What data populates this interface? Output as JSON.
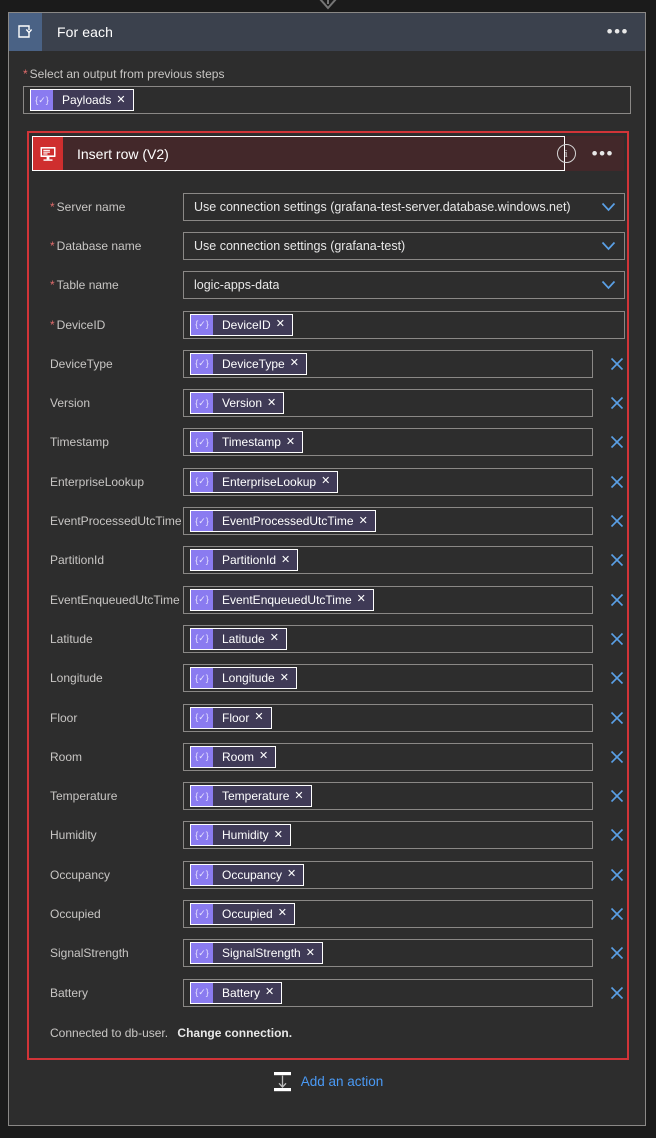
{
  "foreach": {
    "icon": "loop-icon",
    "title": "For each",
    "menu_label": "•••",
    "select_output": {
      "required_marker": "*",
      "label": "Select an output from previous steps",
      "token": {
        "icon_glyph": "{✓}",
        "label": "Payloads",
        "remove": "✕"
      }
    }
  },
  "action": {
    "icon": "sql-server-icon",
    "title": "Insert row (V2)",
    "info_label": "i",
    "menu_label": "•••",
    "accent_color": "#d13438",
    "header_bg": "#43282a",
    "dropdowns": [
      {
        "label": "Server name",
        "required": true,
        "value": "Use connection settings (grafana-test-server.database.windows.net)"
      },
      {
        "label": "Database name",
        "required": true,
        "value": "Use connection settings (grafana-test)"
      },
      {
        "label": "Table name",
        "required": true,
        "value": "logic-apps-data"
      }
    ],
    "fields": [
      {
        "label": "DeviceID",
        "required": true,
        "token": "DeviceID",
        "removable": false
      },
      {
        "label": "DeviceType",
        "required": false,
        "token": "DeviceType",
        "removable": true
      },
      {
        "label": "Version",
        "required": false,
        "token": "Version",
        "removable": true
      },
      {
        "label": "Timestamp",
        "required": false,
        "token": "Timestamp",
        "removable": true
      },
      {
        "label": "EnterpriseLookup",
        "required": false,
        "token": "EnterpriseLookup",
        "removable": true
      },
      {
        "label": "EventProcessedUtcTime",
        "required": false,
        "token": "EventProcessedUtcTime",
        "removable": true
      },
      {
        "label": "PartitionId",
        "required": false,
        "token": "PartitionId",
        "removable": true
      },
      {
        "label": "EventEnqueuedUtcTime",
        "required": false,
        "token": "EventEnqueuedUtcTime",
        "removable": true
      },
      {
        "label": "Latitude",
        "required": false,
        "token": "Latitude",
        "removable": true
      },
      {
        "label": "Longitude",
        "required": false,
        "token": "Longitude",
        "removable": true
      },
      {
        "label": "Floor",
        "required": false,
        "token": "Floor",
        "removable": true
      },
      {
        "label": "Room",
        "required": false,
        "token": "Room",
        "removable": true
      },
      {
        "label": "Temperature",
        "required": false,
        "token": "Temperature",
        "removable": true
      },
      {
        "label": "Humidity",
        "required": false,
        "token": "Humidity",
        "removable": true
      },
      {
        "label": "Occupancy",
        "required": false,
        "token": "Occupancy",
        "removable": true
      },
      {
        "label": "Occupied",
        "required": false,
        "token": "Occupied",
        "removable": true
      },
      {
        "label": "SignalStrength",
        "required": false,
        "token": "SignalStrength",
        "removable": true
      },
      {
        "label": "Battery",
        "required": false,
        "token": "Battery",
        "removable": true
      }
    ],
    "token_icon_glyph": "{✓}",
    "token_remove_glyph": "✕",
    "connection": {
      "text": "Connected to db-user.",
      "change_link": "Change connection."
    }
  },
  "add_action": {
    "icon": "insert-action-icon",
    "label": "Add an action",
    "color": "#4a9af5"
  }
}
